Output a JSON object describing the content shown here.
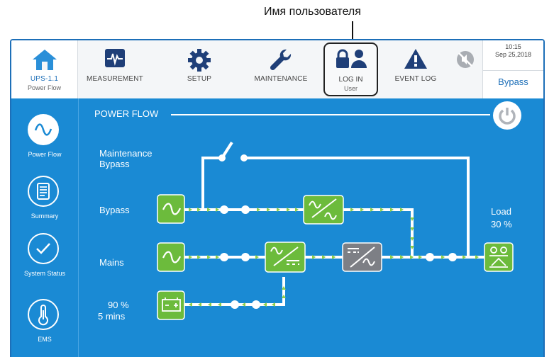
{
  "annotation": {
    "text": "Имя пользователя"
  },
  "topnav": {
    "home": {
      "label": "UPS-1.1",
      "sub": "Power Flow"
    },
    "measurement": {
      "label": "MEASUREMENT"
    },
    "setup": {
      "label": "SETUP"
    },
    "maintenance": {
      "label": "MAINTENANCE"
    },
    "login": {
      "label": "LOG IN",
      "sub": "User"
    },
    "eventlog": {
      "label": "EVENT LOG"
    }
  },
  "status": {
    "time": "10:15",
    "date": "Sep 25,2018",
    "mode": "Bypass"
  },
  "sidebar": {
    "items": [
      {
        "label": "Power Flow",
        "icon": "sine-wave-icon"
      },
      {
        "label": "Summary",
        "icon": "document-icon"
      },
      {
        "label": "System Status",
        "icon": "checkmark-icon"
      },
      {
        "label": "EMS",
        "icon": "thermometer-icon"
      }
    ]
  },
  "power_flow": {
    "title": "POWER FLOW",
    "maintenance_bypass": "Maintenance\nBypass",
    "bypass": "Bypass",
    "mains": "Mains",
    "battery_percent": "90 %",
    "battery_time": "5 mins",
    "load_label": "Load",
    "load_percent": "30 %"
  },
  "colors": {
    "accent": "#1d6fb8",
    "panel_blue": "#1a8ad4",
    "module_green": "#6cbb3c",
    "inverter_gray": "#7d7f85",
    "arrow_green": "#8fd04a"
  }
}
